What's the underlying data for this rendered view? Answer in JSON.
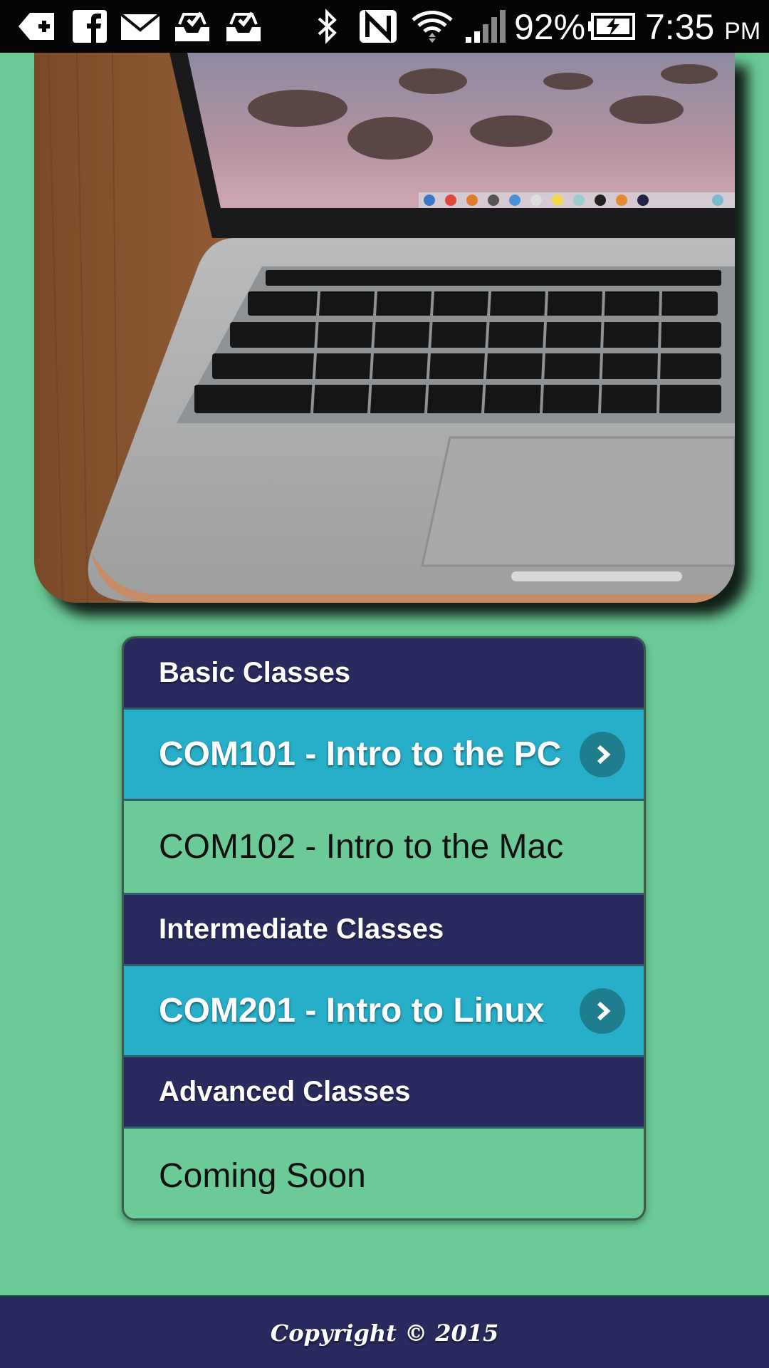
{
  "status_bar": {
    "battery_percent": "92%",
    "time": "7:35",
    "ampm": "PM",
    "icons": [
      "plus-notification-icon",
      "facebook-icon",
      "mail-icon",
      "inbox-check-icon",
      "inbox-check-icon",
      "bluetooth-icon",
      "nfc-icon",
      "wifi-icon",
      "cell-signal-icon",
      "battery-charging-icon"
    ]
  },
  "hero": {
    "image": "laptop-photo"
  },
  "class_list": {
    "sections": [
      {
        "header": "Basic Classes",
        "items": [
          {
            "label": "COM101 - Intro to the PC",
            "linked": true
          },
          {
            "label": "COM102 - Intro to the Mac",
            "linked": false
          }
        ]
      },
      {
        "header": "Intermediate Classes",
        "items": [
          {
            "label": "COM201 - Intro to Linux",
            "linked": true
          }
        ]
      },
      {
        "header": "Advanced Classes",
        "items": [
          {
            "label": "Coming Soon",
            "linked": false
          }
        ]
      }
    ]
  },
  "footer": {
    "copyright": "Copyright © 2015"
  },
  "colors": {
    "page_bg": "#6bca96",
    "header_bg": "#292a5e",
    "link_bg": "#27aec8",
    "chevron_bg": "#1f7e8e"
  }
}
